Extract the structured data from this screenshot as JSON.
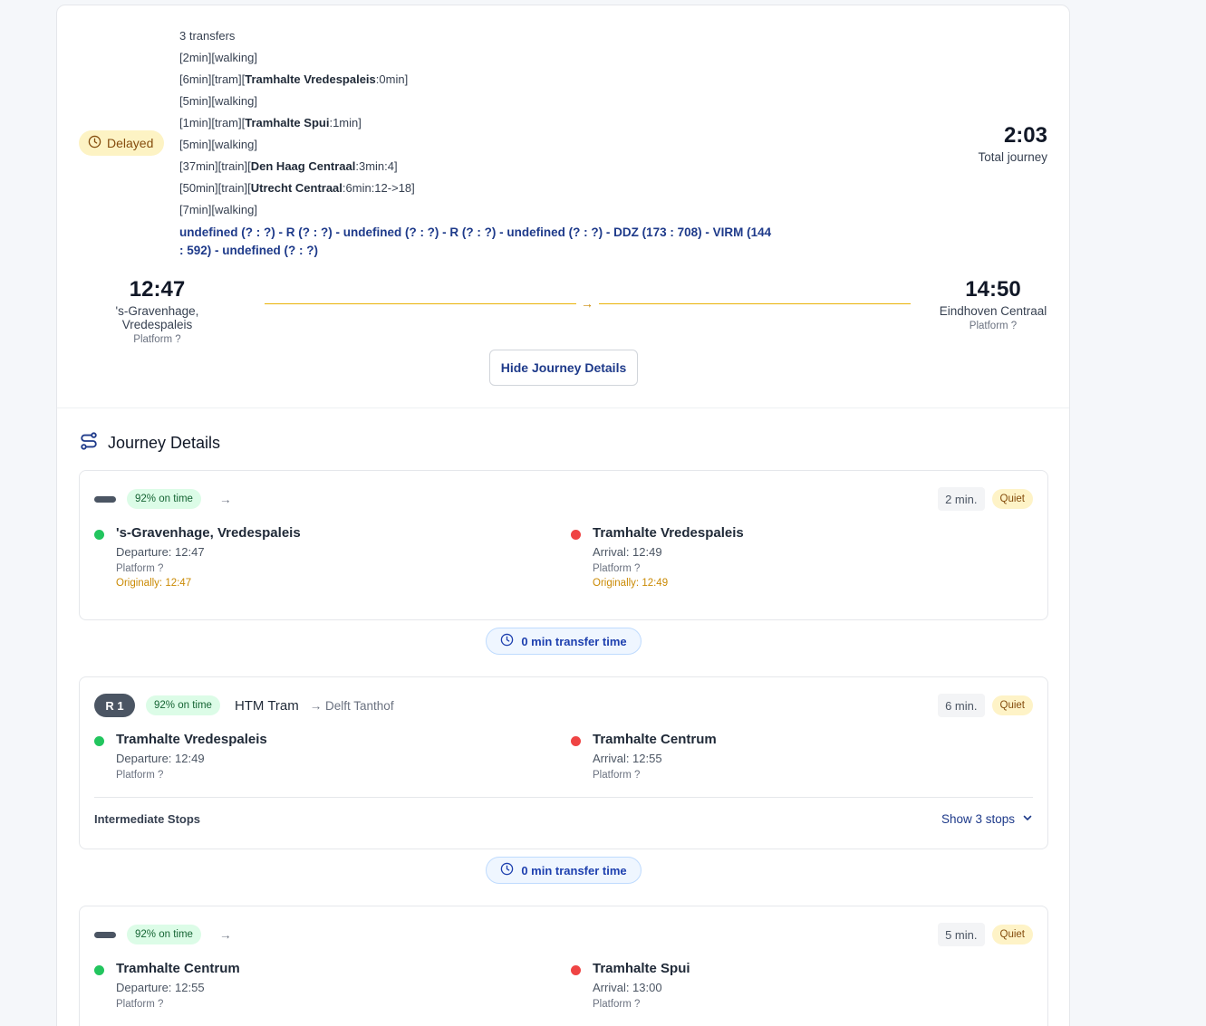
{
  "summary": {
    "status": "Delayed",
    "transfers": "3 transfers",
    "legs": [
      {
        "pre": "[2min][walking]",
        "stop": "",
        "post": ""
      },
      {
        "pre": "[6min][tram][",
        "stop": "Tramhalte Vredespaleis",
        "post": ":0min]"
      },
      {
        "pre": "[5min][walking]",
        "stop": "",
        "post": ""
      },
      {
        "pre": "[1min][tram][",
        "stop": "Tramhalte Spui",
        "post": ":1min]"
      },
      {
        "pre": "[5min][walking]",
        "stop": "",
        "post": ""
      },
      {
        "pre": "[37min][train][",
        "stop": "Den Haag Centraal",
        "post": ":3min:4]"
      },
      {
        "pre": "[50min][train][",
        "stop": "Utrecht Centraal",
        "post": ":6min:12->18]"
      },
      {
        "pre": "[7min][walking]",
        "stop": "",
        "post": ""
      }
    ],
    "train_types": "undefined (? : ?) - R (? : ?) - undefined (? : ?) - R (? : ?) - undefined (? : ?) - DDZ (173 : 708) - VIRM (144 : 592) - undefined (? : ?)",
    "total_time": "2:03",
    "total_label": "Total journey",
    "departure": {
      "time": "12:47",
      "station": "'s-Gravenhage, Vredespaleis",
      "platform": "Platform ?"
    },
    "arrival": {
      "time": "14:50",
      "station": "Eindhoven Centraal",
      "platform": "Platform ?"
    },
    "route_arrow": "→",
    "hide_button": "Hide Journey Details"
  },
  "details": {
    "title": "Journey Details",
    "legs": [
      {
        "line": "",
        "ontime": "92% on time",
        "operator": "",
        "direction": "→",
        "duration": "2 min.",
        "crowd": "Quiet",
        "from": {
          "name": "'s-Gravenhage, Vredespaleis",
          "time": "Departure: 12:47",
          "platform": "Platform ?",
          "original": "Originally: 12:47"
        },
        "to": {
          "name": "Tramhalte Vredespaleis",
          "time": "Arrival: 12:49",
          "platform": "Platform ?",
          "original": "Originally: 12:49"
        }
      },
      {
        "line": "R 1",
        "ontime": "92% on time",
        "operator": "HTM Tram",
        "direction": "→ Delft Tanthof",
        "duration": "6 min.",
        "crowd": "Quiet",
        "from": {
          "name": "Tramhalte Vredespaleis",
          "time": "Departure: 12:49",
          "platform": "Platform ?"
        },
        "to": {
          "name": "Tramhalte Centrum",
          "time": "Arrival: 12:55",
          "platform": "Platform ?"
        },
        "intermediate_label": "Intermediate Stops",
        "show_stops": "Show 3 stops"
      },
      {
        "line": "",
        "ontime": "92% on time",
        "operator": "",
        "direction": "→",
        "duration": "5 min.",
        "crowd": "Quiet",
        "from": {
          "name": "Tramhalte Centrum",
          "time": "Departure: 12:55",
          "platform": "Platform ?"
        },
        "to": {
          "name": "Tramhalte Spui",
          "time": "Arrival: 13:00",
          "platform": "Platform ?"
        }
      }
    ],
    "transfers": [
      {
        "label": "0 min transfer time"
      },
      {
        "label": "0 min transfer time"
      }
    ]
  },
  "colors": {
    "accent": "#1e3a8a",
    "delay": "#ca8a04",
    "ontime": "#166534",
    "departure_dot": "#22c55e",
    "arrival_dot": "#ef4444"
  }
}
